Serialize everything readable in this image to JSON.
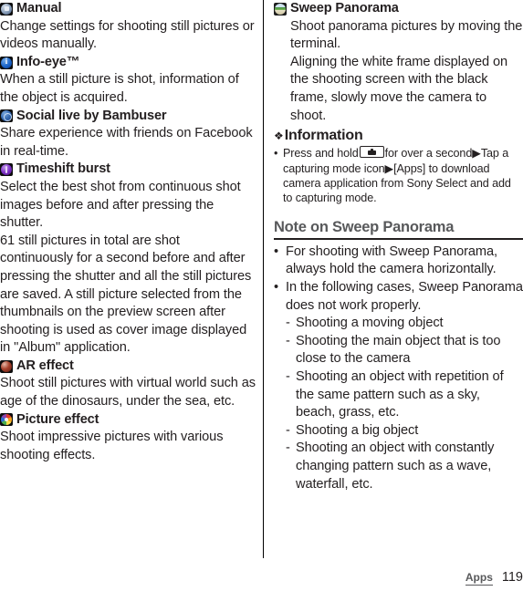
{
  "left_column": {
    "entries": [
      {
        "icon": "manual-dial-icon",
        "title": "Manual",
        "body": "Change settings for shooting still pictures or videos manually."
      },
      {
        "icon": "info-eye-icon",
        "title": "Info-eye™",
        "body": "When a still picture is shot, information of the object is acquired."
      },
      {
        "icon": "social-live-icon",
        "title": "Social live by Bambuser",
        "body": "Share experience with friends on Facebook in real-time."
      },
      {
        "icon": "timeshift-burst-icon",
        "title": "Timeshift burst",
        "body": "Select the best shot from continuous shot images before and after pressing the shutter.",
        "body2": "61 still pictures in total are shot continuously for a second before and after pressing the shutter and all the still pictures are saved. A still picture selected from the thumbnails on the preview screen after shooting is used as cover image displayed in \"Album\" application."
      },
      {
        "icon": "ar-effect-icon",
        "title": "AR effect",
        "body": "Shoot still pictures with virtual world such as age of the dinosaurs, under the sea, etc."
      },
      {
        "icon": "picture-effect-icon",
        "title": "Picture effect",
        "body": "Shoot impressive pictures with various shooting effects."
      }
    ]
  },
  "right_column": {
    "entry": {
      "icon": "sweep-panorama-icon",
      "title": "Sweep Panorama",
      "body": "Shoot panorama pictures by moving the terminal.",
      "body2": "Aligning the white frame displayed on the shooting screen with the black frame, slowly move the camera to shoot."
    },
    "information": {
      "bullet_glyph": "❖",
      "title": "Information",
      "items": [
        {
          "bullet": "•",
          "text_before_key": "Press and hold",
          "key_icon": "camera-key-icon",
          "text_after_key": "for over a second▶Tap a capturing mode icon▶[Apps] to download camera application from Sony Select and add to capturing mode."
        }
      ]
    },
    "note_section": {
      "heading": "Note on Sweep Panorama",
      "heading_color": "#58595b",
      "rule_color": "#231f20",
      "bullets": [
        {
          "bullet": "•",
          "text": "For shooting with Sweep Panorama, always hold the camera horizontally."
        },
        {
          "bullet": "•",
          "text": "In the following cases, Sweep Panorama does not work properly.",
          "sub_items": [
            {
              "dash": "-",
              "text": "Shooting a moving object"
            },
            {
              "dash": "-",
              "text": "Shooting the main object that is too close to the camera"
            },
            {
              "dash": "-",
              "text": "Shooting an object with repetition of the same pattern such as a sky, beach, grass, etc."
            },
            {
              "dash": "-",
              "text": "Shooting a big object"
            },
            {
              "dash": "-",
              "text": "Shooting an object with constantly changing pattern such as a wave, waterfall, etc."
            }
          ]
        }
      ]
    }
  },
  "footer": {
    "chapter": "Apps",
    "page_number": "119"
  }
}
